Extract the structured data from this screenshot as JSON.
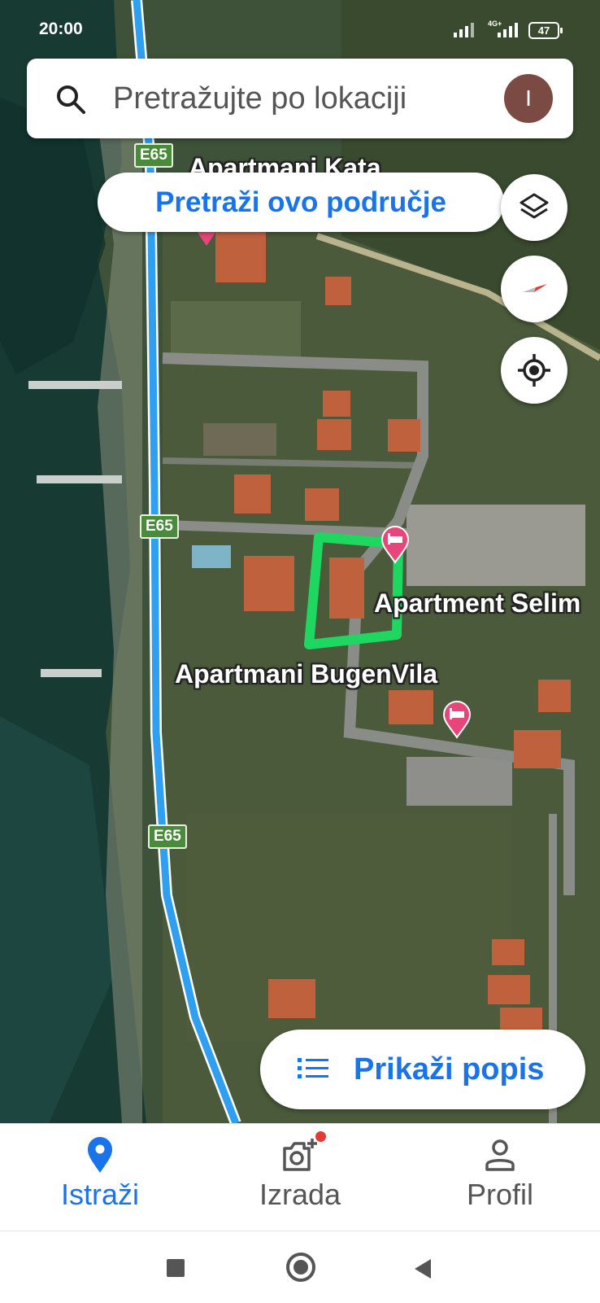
{
  "status_bar": {
    "time": "20:00",
    "network": "4G+",
    "battery": "47"
  },
  "search": {
    "placeholder": "Pretražujte po lokaciji",
    "avatar_initial": "I"
  },
  "search_area_button": "Pretraži ovo područje",
  "map": {
    "road_shield": "E65",
    "labels": {
      "top_place": "Apartmani Kata",
      "apartment_selim": "Apartment Selim",
      "bugenvila": "Apartmani BugenVila"
    },
    "colors": {
      "route": "#2f9ff2",
      "highlight": "#1ed760",
      "pin": "#e8457a"
    }
  },
  "map_controls": [
    "layers-icon",
    "compass-icon",
    "my-location-icon"
  ],
  "list_button": {
    "label": "Prikaži popis"
  },
  "bottom_nav": {
    "explore": "Istraži",
    "create": "Izrada",
    "profile": "Profil"
  }
}
